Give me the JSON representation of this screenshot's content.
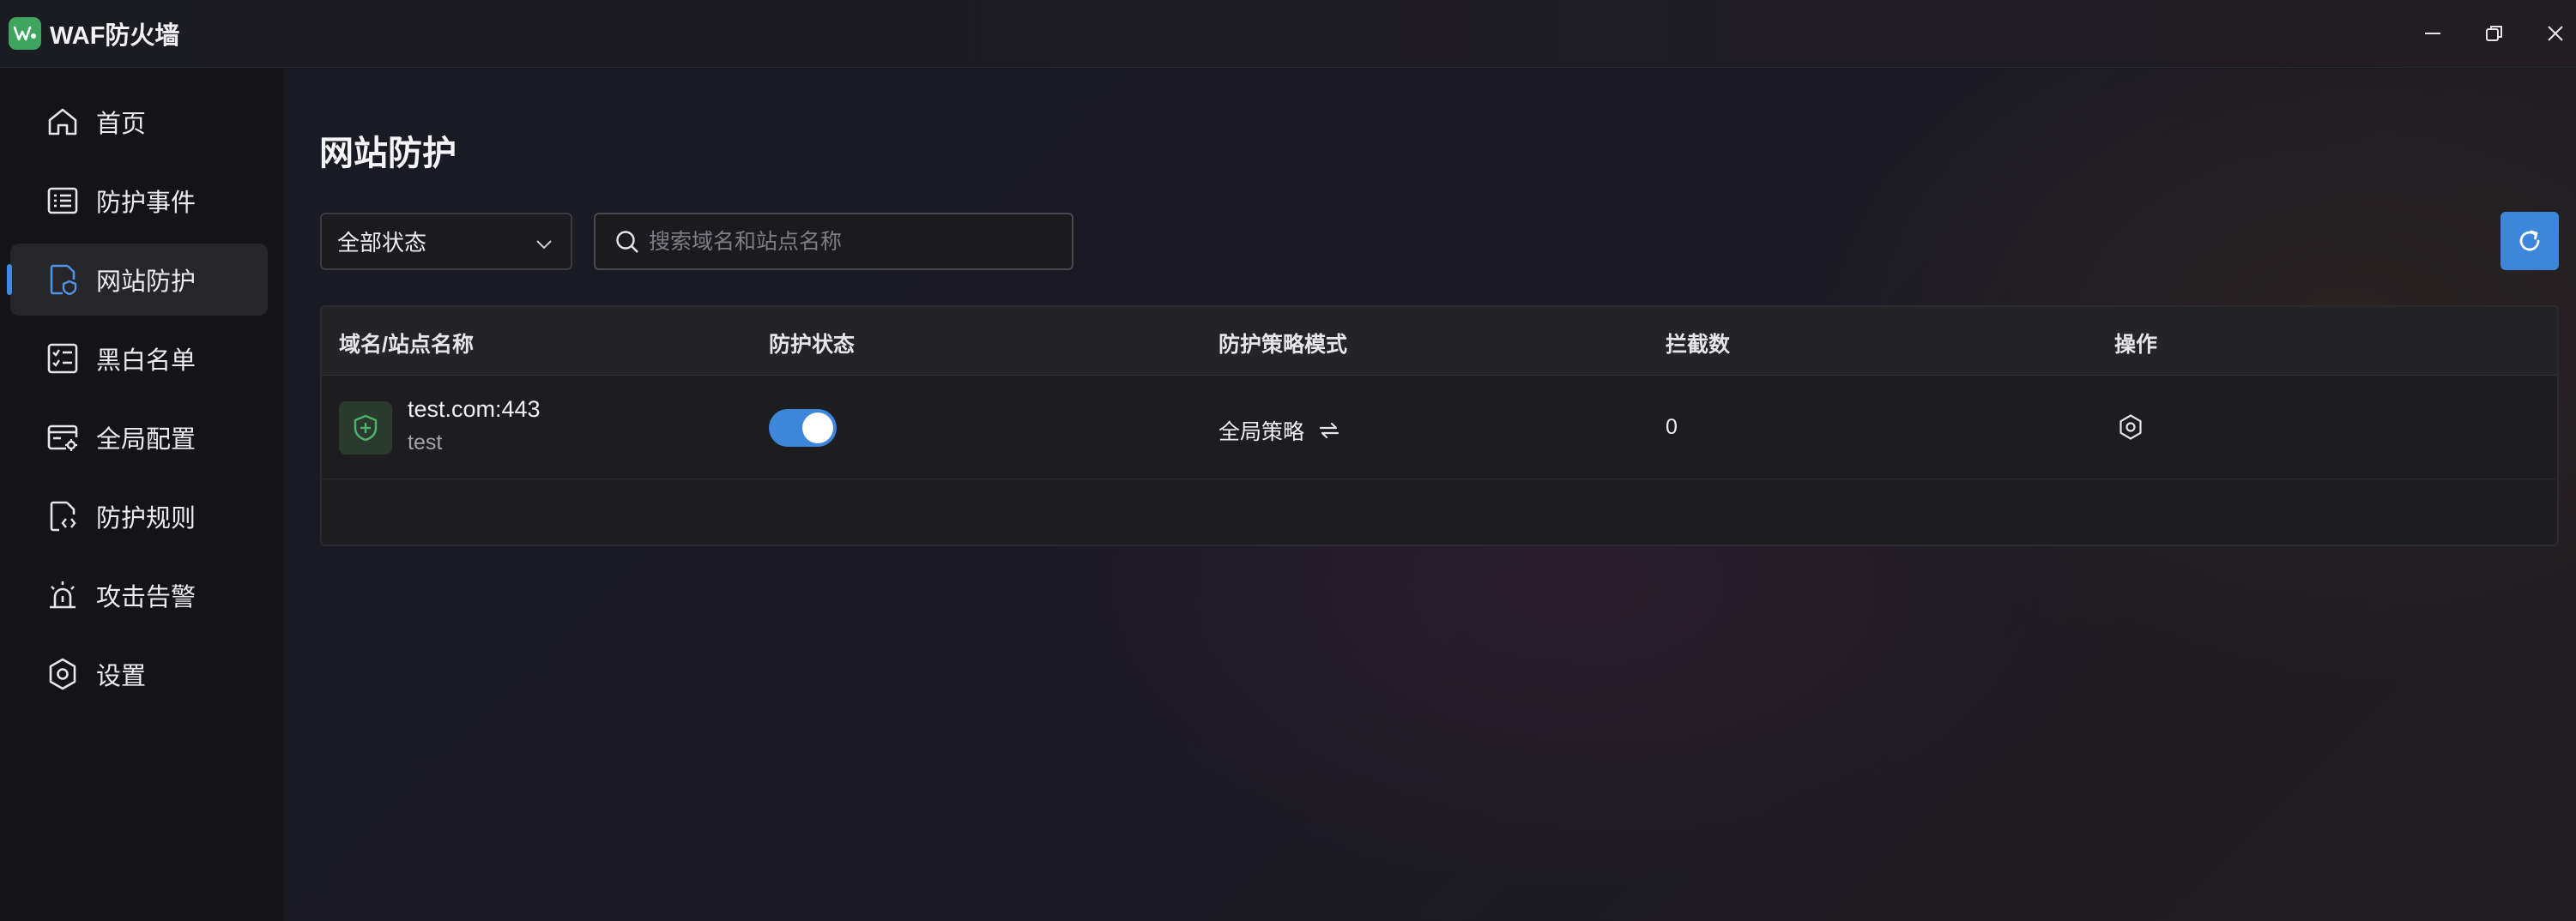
{
  "app": {
    "title": "WAF防火墙",
    "logo_text": "WAF"
  },
  "sidebar": {
    "items": [
      {
        "label": "首页",
        "icon": "home-icon"
      },
      {
        "label": "防护事件",
        "icon": "list-icon"
      },
      {
        "label": "网站防护",
        "icon": "site-shield-icon",
        "active": true
      },
      {
        "label": "黑白名单",
        "icon": "checklist-icon"
      },
      {
        "label": "全局配置",
        "icon": "config-card-icon"
      },
      {
        "label": "防护规则",
        "icon": "rule-file-icon"
      },
      {
        "label": "攻击告警",
        "icon": "alarm-icon"
      },
      {
        "label": "设置",
        "icon": "settings-icon"
      }
    ]
  },
  "main": {
    "title": "网站防护",
    "filter": {
      "selected": "全部状态"
    },
    "search": {
      "placeholder": "搜索域名和站点名称",
      "value": ""
    },
    "table": {
      "headers": [
        "域名/站点名称",
        "防护状态",
        "防护策略模式",
        "拦截数",
        "操作"
      ],
      "rows": [
        {
          "domain": "test.com:443",
          "name": "test",
          "status_on": true,
          "mode": "全局策略",
          "blocked": "0"
        }
      ]
    }
  },
  "colors": {
    "accent": "#3d86db",
    "logo": "#3fa45e",
    "shield": "#4fb36a"
  }
}
